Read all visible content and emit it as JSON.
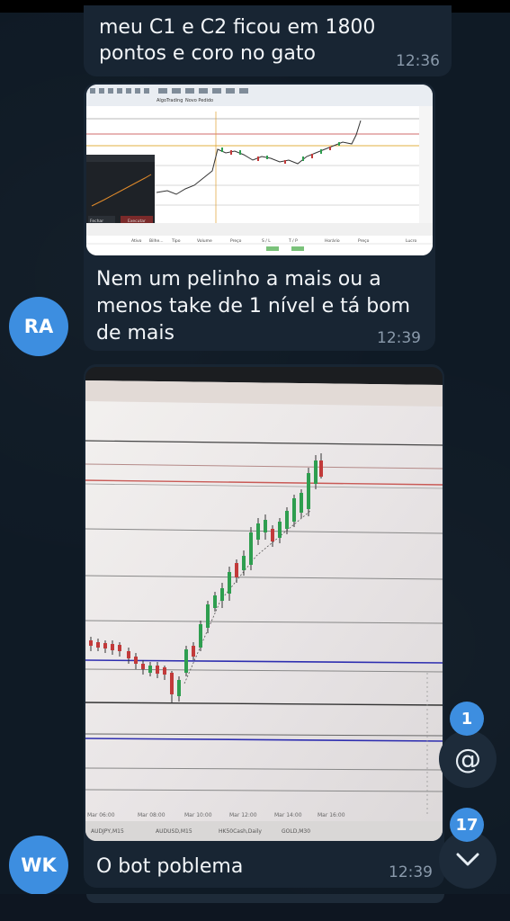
{
  "messages": [
    {
      "line1": "meu C1 e C2 ficou em 1800",
      "line2": "pontos e coro no gato",
      "time": "12:36"
    },
    {
      "line1": "Nem um pelinho a mais ou a",
      "line2": "menos take de 1 nível e tá bom",
      "line3": "de mais",
      "time": "12:39",
      "sender_initials": "RA"
    },
    {
      "text": "O bot poblema",
      "time": "12:39",
      "sender_initials": "WK"
    }
  ],
  "screenshot_1": {
    "toolbar_tab_1": "AlgoTrading",
    "toolbar_tab_2": "Novo Pedido",
    "dialog_buttons": [
      "Fechar",
      "Executar"
    ],
    "table_headers": [
      "Ativo",
      "Bilhe...",
      "Tipo",
      "Volume",
      "Preço",
      "S / L",
      "T / P",
      "Horário",
      "Preço",
      "Lucro"
    ]
  },
  "photo_tabs": [
    "AUDJPY,M15",
    "AUDUSD,M15",
    "HK50Cash,Daily",
    "GOLD,M30"
  ],
  "photo_axis": [
    "Mar 06:00",
    "Mar 08:00",
    "Mar 10:00",
    "Mar 12:00",
    "Mar 14:00",
    "Mar 16:00"
  ],
  "badges": {
    "mentions": "1",
    "unread": "17"
  },
  "colors": {
    "bubble": "#182533",
    "background": "#0e1621",
    "avatar_ra": "#3d8ee0",
    "avatar_wk": "#3d8ee0",
    "badge": "#3d8ee0"
  },
  "icons": {
    "mention": "at-icon",
    "scroll_down": "chevron-down-icon"
  }
}
